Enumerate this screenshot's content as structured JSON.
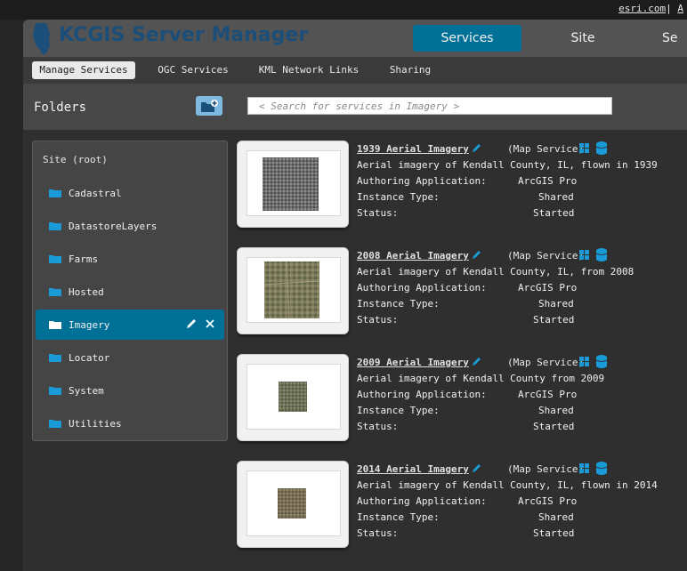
{
  "top_links": {
    "esri": "esri.com",
    "sep": "|",
    "next": "A"
  },
  "header": {
    "title": "KCGIS Server Manager",
    "nav": [
      "Services",
      "Site",
      "Se"
    ],
    "active_nav": "Services"
  },
  "subnav": [
    "Manage Services",
    "OGC Services",
    "KML Network Links",
    "Sharing"
  ],
  "folders_panel": {
    "title": "Folders",
    "search_placeholder": "< Search for services in Imagery >",
    "root": "Site (root)",
    "items": [
      {
        "label": "Cadastral"
      },
      {
        "label": "DatastoreLayers"
      },
      {
        "label": "Farms"
      },
      {
        "label": "Hosted"
      },
      {
        "label": "Imagery"
      },
      {
        "label": "Locator"
      },
      {
        "label": "System"
      },
      {
        "label": "Utilities"
      }
    ],
    "selected": "Imagery"
  },
  "labels": {
    "authoring": "Authoring Application:",
    "instance": "Instance Type:",
    "status": "Status:",
    "type": "(Map Service)"
  },
  "services": [
    {
      "title": "1939 Aerial Imagery",
      "description": "Aerial imagery of Kendall County, IL, flown in 1939",
      "authoring": "ArcGIS Pro",
      "instance": "Shared",
      "status": "Started"
    },
    {
      "title": "2008 Aerial Imagery",
      "description": "Aerial imagery of Kendall County, IL, from 2008",
      "authoring": "ArcGIS Pro",
      "instance": "Shared",
      "status": "Started"
    },
    {
      "title": "2009 Aerial Imagery",
      "description": "Aerial imagery of Kendall County from 2009",
      "authoring": "ArcGIS Pro",
      "instance": "Shared",
      "status": "Started"
    },
    {
      "title": "2014 Aerial Imagery",
      "description": "Aerial imagery of Kendall County, IL, flown in 2014",
      "authoring": "ArcGIS Pro",
      "instance": "Shared",
      "status": "Started"
    }
  ],
  "colors": {
    "accent": "#007096",
    "title": "#1b4e79",
    "icon": "#1a9bd7"
  }
}
